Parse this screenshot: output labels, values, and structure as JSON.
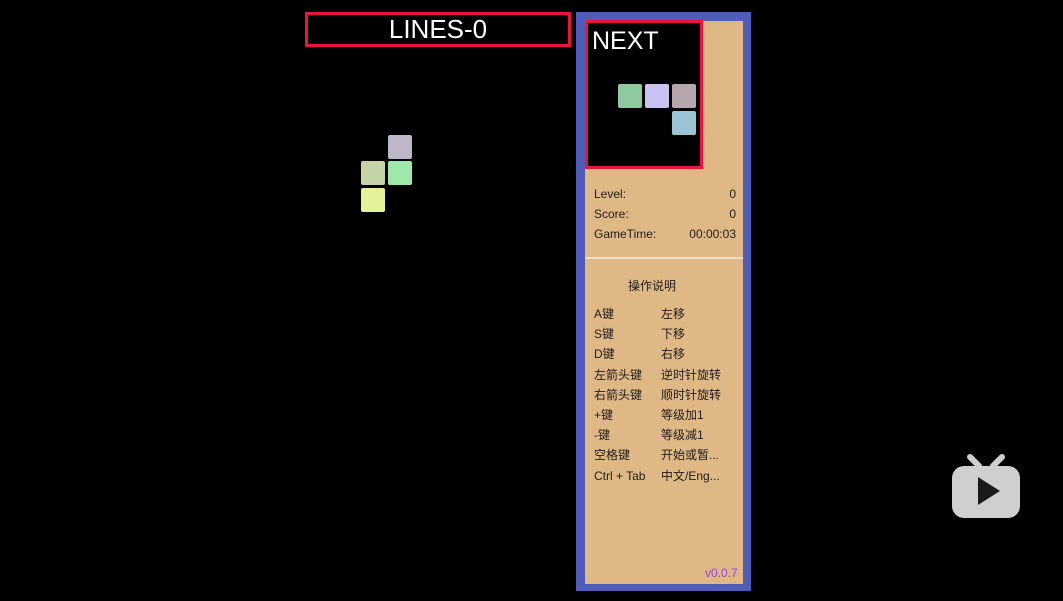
{
  "header": {
    "lines_label": "LINES-0"
  },
  "next_panel": {
    "label": "NEXT"
  },
  "stats": {
    "level_label": "Level:",
    "level_value": "0",
    "score_label": "Score:",
    "score_value": "0",
    "time_label": "GameTime:",
    "time_value": "00:00:03"
  },
  "help": {
    "title": "操作说明",
    "rows": [
      {
        "key": "A键",
        "action": "左移"
      },
      {
        "key": "S键",
        "action": "下移"
      },
      {
        "key": "D键",
        "action": "右移"
      },
      {
        "key": "左箭头键",
        "action": "逆时针旋转"
      },
      {
        "key": "右箭头键",
        "action": "顺时针旋转"
      },
      {
        "key": "+键",
        "action": "等级加1"
      },
      {
        "key": "-键",
        "action": "等级减1"
      },
      {
        "key": "空格键",
        "action": "开始或暂..."
      },
      {
        "key": "Ctrl + Tab",
        "action": "中文/Eng..."
      }
    ]
  },
  "version": "v0.0.7",
  "colors": {
    "panel_border": "#4f5cb8",
    "panel_bg": "#e0b886",
    "highlight_border": "#e8163c",
    "version_text": "#9b3fd8"
  },
  "icons": {
    "watermark": "video-play-icon"
  }
}
